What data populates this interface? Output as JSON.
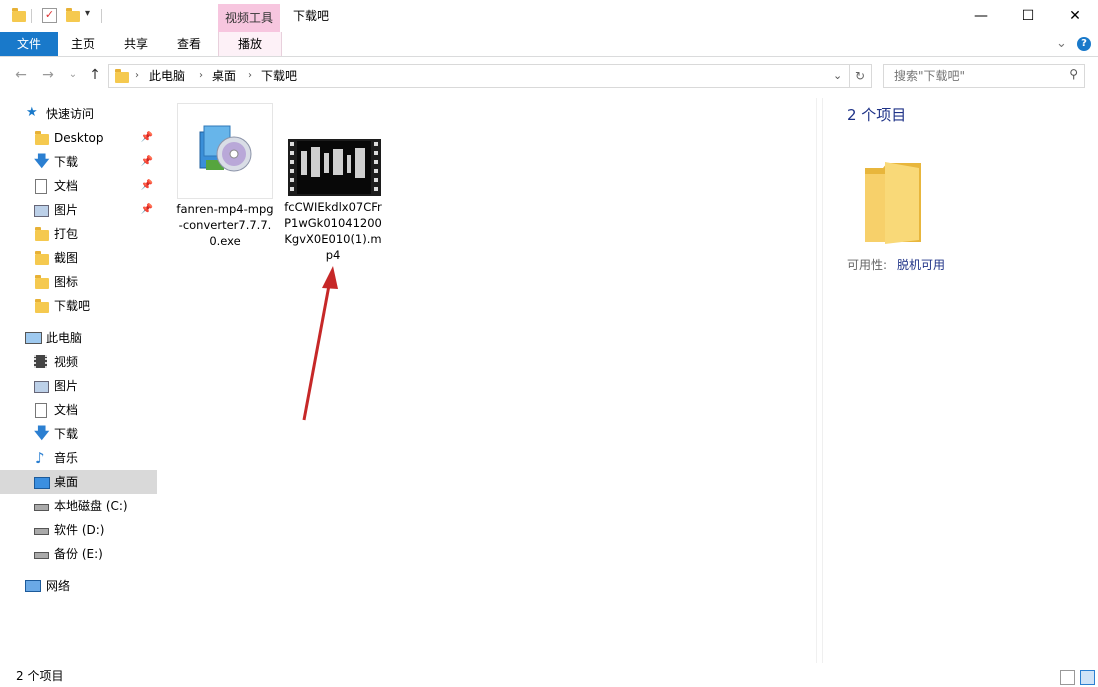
{
  "window": {
    "title": "下载吧",
    "contextual_tab_group": "视频工具",
    "minimize": "—",
    "maximize": "☐",
    "close": "✕"
  },
  "ribbon": {
    "tabs": [
      {
        "label": "文件"
      },
      {
        "label": "主页"
      },
      {
        "label": "共享"
      },
      {
        "label": "查看"
      },
      {
        "label": "播放"
      }
    ],
    "collapse": "⌄",
    "help": "?"
  },
  "address": {
    "crumbs": [
      "此电脑",
      "桌面",
      "下载吧"
    ],
    "search_placeholder": "搜索\"下载吧\""
  },
  "sidebar": {
    "quick_access": {
      "label": "快速访问",
      "items": [
        {
          "label": "Desktop",
          "icon": "folder-icon",
          "pinned": true
        },
        {
          "label": "下载",
          "icon": "download-arrow-icon",
          "pinned": true
        },
        {
          "label": "文档",
          "icon": "document-icon",
          "pinned": true
        },
        {
          "label": "图片",
          "icon": "picture-icon",
          "pinned": true
        },
        {
          "label": "打包",
          "icon": "folder-icon",
          "pinned": false
        },
        {
          "label": "截图",
          "icon": "folder-icon",
          "pinned": false
        },
        {
          "label": "图标",
          "icon": "folder-icon",
          "pinned": false
        },
        {
          "label": "下载吧",
          "icon": "folder-icon",
          "pinned": false
        }
      ]
    },
    "this_pc": {
      "label": "此电脑",
      "items": [
        {
          "label": "视频",
          "icon": "video-icon"
        },
        {
          "label": "图片",
          "icon": "picture-icon"
        },
        {
          "label": "文档",
          "icon": "document-icon"
        },
        {
          "label": "下载",
          "icon": "download-arrow-icon"
        },
        {
          "label": "音乐",
          "icon": "music-note-icon"
        },
        {
          "label": "桌面",
          "icon": "desktop-icon",
          "selected": true
        },
        {
          "label": "本地磁盘 (C:)",
          "icon": "drive-icon"
        },
        {
          "label": "软件 (D:)",
          "icon": "drive-icon"
        },
        {
          "label": "备份 (E:)",
          "icon": "drive-icon"
        }
      ]
    },
    "network": {
      "label": "网络"
    }
  },
  "files": [
    {
      "name": "fanren-mp4-mpg-converter7.7.7.0.exe",
      "icon": "installer-disc-icon"
    },
    {
      "name": "fcCWIEkdlx07CFrP1wGk01041200KgvX0E010(1).mp4",
      "icon": "video-thumbnail-icon"
    }
  ],
  "details": {
    "count": "2 个项目",
    "availability_label": "可用性:",
    "availability_value": "脱机可用"
  },
  "status": {
    "count": "2 个项目"
  },
  "colors": {
    "accent": "#1979ca",
    "video_tools": "#f7c6df",
    "folder": "#f5c94f",
    "annotation_arrow": "#c62828"
  }
}
